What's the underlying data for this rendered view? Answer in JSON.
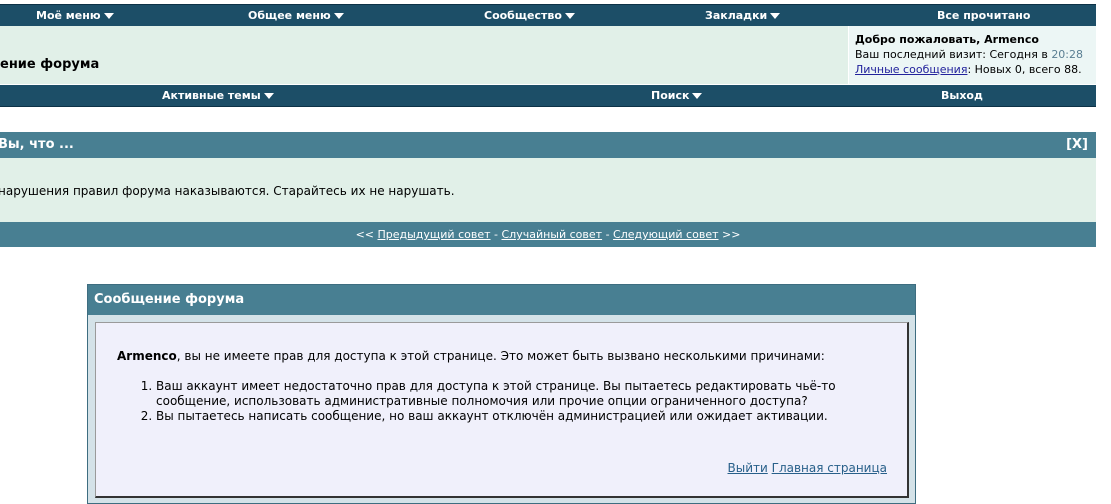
{
  "navbar": {
    "items": [
      {
        "label": "Моё меню",
        "has_arrow": true
      },
      {
        "label": "Общее меню",
        "has_arrow": true
      },
      {
        "label": "Сообщество",
        "has_arrow": true
      },
      {
        "label": "Закладки",
        "has_arrow": true
      },
      {
        "label": "Все прочитано",
        "has_arrow": false
      }
    ]
  },
  "header": {
    "title": "ение форума",
    "welcome": {
      "title": "Добро пожаловать, Armenco",
      "last_visit_prefix": "Ваш последний визит: Сегодня в ",
      "last_visit_time": "20:28",
      "pm_link": "Личные сообщения",
      "pm_suffix": ": Новых 0, всего 88."
    }
  },
  "navbar2": {
    "items": [
      {
        "label": "Активные темы",
        "has_arrow": true
      },
      {
        "label": "Поиск",
        "has_arrow": true
      },
      {
        "label": "Выход",
        "has_arrow": false
      }
    ]
  },
  "tip": {
    "title": "Вы, что ...",
    "close_label": "[X]",
    "text": "нарушения правил форума наказываются. Старайтесь их не нарушать.",
    "footer": {
      "prev_marker": "<< ",
      "prev_label": "Предыдущий совет",
      "sep1": " - ",
      "random_label": "Случайный совет",
      "sep2": " - ",
      "next_label": "Следующий совет",
      "next_marker": " >>"
    }
  },
  "message": {
    "title": "Сообщение форума",
    "username": "Armenco",
    "intro_text": ", вы не имеете прав для доступа к этой странице. Это может быть вызвано несколькими причинами:",
    "reasons": [
      "Ваш аккаунт имеет недостаточно прав для доступа к этой странице. Вы пытаетесь редактировать чьё-то сообщение, использовать административные полномочия или прочие опции ограниченного доступа?",
      "Вы пытаетесь написать сообщение, но ваш аккаунт отключён администрацией или ожидает активации."
    ],
    "logout_link": "Выйти",
    "home_link": "Главная страница"
  }
}
